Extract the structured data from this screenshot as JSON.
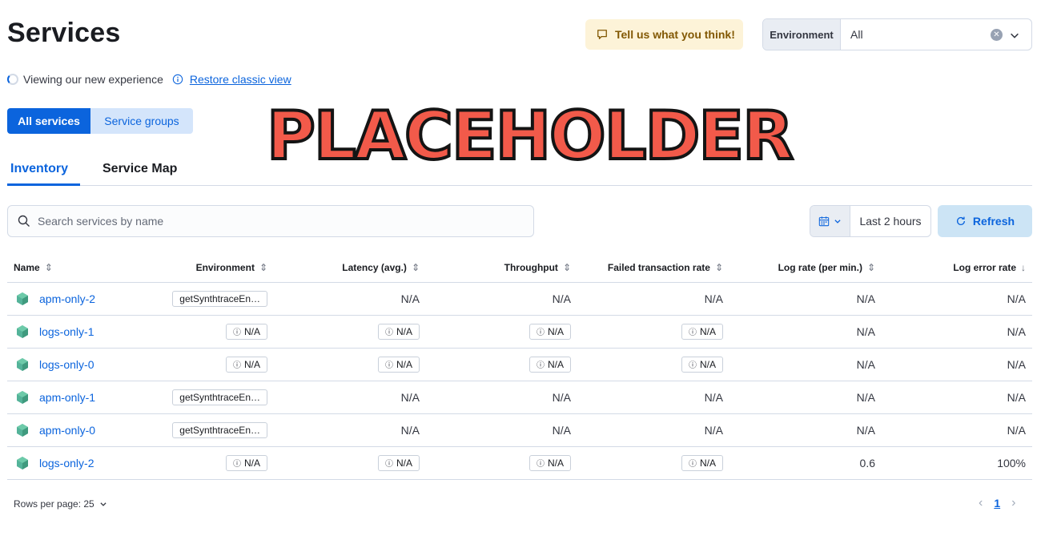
{
  "header": {
    "title": "Services",
    "feedback_label": "Tell us what you think!",
    "environment": {
      "label": "Environment",
      "value": "All"
    }
  },
  "experience": {
    "text": "Viewing our new experience",
    "restore_link": "Restore classic view"
  },
  "service_toggle": {
    "all_services": "All services",
    "service_groups": "Service groups"
  },
  "overlay_text": "PLACEHOLDER",
  "tabs": [
    {
      "label": "Inventory",
      "active": true
    },
    {
      "label": "Service Map",
      "active": false
    }
  ],
  "search": {
    "placeholder": "Search services by name",
    "value": ""
  },
  "date_picker": {
    "value": "Last 2 hours"
  },
  "refresh_label": "Refresh",
  "table": {
    "columns": [
      {
        "label": "Name",
        "sort": "both"
      },
      {
        "label": "Environment",
        "sort": "both"
      },
      {
        "label": "Latency (avg.)",
        "sort": "both"
      },
      {
        "label": "Throughput",
        "sort": "both"
      },
      {
        "label": "Failed transaction rate",
        "sort": "both"
      },
      {
        "label": "Log rate (per min.)",
        "sort": "both"
      },
      {
        "label": "Log error rate",
        "sort": "desc"
      }
    ],
    "rows": [
      {
        "name": "apm-only-2",
        "environment": "getSynthtraceEn…",
        "env_badge_info": false,
        "latency": "N/A",
        "latency_badge": false,
        "throughput": "N/A",
        "throughput_badge": false,
        "failed": "N/A",
        "failed_badge": false,
        "log_rate": "N/A",
        "log_error_rate": "N/A"
      },
      {
        "name": "logs-only-1",
        "environment": "N/A",
        "env_badge_info": true,
        "latency": "N/A",
        "latency_badge": true,
        "throughput": "N/A",
        "throughput_badge": true,
        "failed": "N/A",
        "failed_badge": true,
        "log_rate": "N/A",
        "log_error_rate": "N/A"
      },
      {
        "name": "logs-only-0",
        "environment": "N/A",
        "env_badge_info": true,
        "latency": "N/A",
        "latency_badge": true,
        "throughput": "N/A",
        "throughput_badge": true,
        "failed": "N/A",
        "failed_badge": true,
        "log_rate": "N/A",
        "log_error_rate": "N/A"
      },
      {
        "name": "apm-only-1",
        "environment": "getSynthtraceEn…",
        "env_badge_info": false,
        "latency": "N/A",
        "latency_badge": false,
        "throughput": "N/A",
        "throughput_badge": false,
        "failed": "N/A",
        "failed_badge": false,
        "log_rate": "N/A",
        "log_error_rate": "N/A"
      },
      {
        "name": "apm-only-0",
        "environment": "getSynthtraceEn…",
        "env_badge_info": false,
        "latency": "N/A",
        "latency_badge": false,
        "throughput": "N/A",
        "throughput_badge": false,
        "failed": "N/A",
        "failed_badge": false,
        "log_rate": "N/A",
        "log_error_rate": "N/A"
      },
      {
        "name": "logs-only-2",
        "environment": "N/A",
        "env_badge_info": true,
        "latency": "N/A",
        "latency_badge": true,
        "throughput": "N/A",
        "throughput_badge": true,
        "failed": "N/A",
        "failed_badge": true,
        "log_rate": "0.6",
        "log_error_rate": "100%"
      }
    ]
  },
  "pagination": {
    "rows_per_page": "Rows per page: 25",
    "current_page": "1"
  },
  "colors": {
    "primary": "#0b64dd",
    "service_icon": "#54b399",
    "feedback_bg": "#fdf3d8",
    "placeholder_fill": "#f25a4a"
  }
}
